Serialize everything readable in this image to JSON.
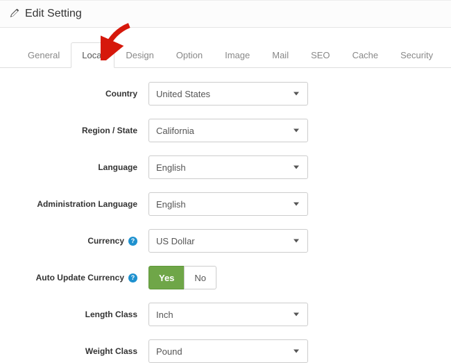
{
  "header": {
    "title": "Edit Setting"
  },
  "tabs": [
    {
      "label": "General"
    },
    {
      "label": "Local"
    },
    {
      "label": "Design"
    },
    {
      "label": "Option"
    },
    {
      "label": "Image"
    },
    {
      "label": "Mail"
    },
    {
      "label": "SEO"
    },
    {
      "label": "Cache"
    },
    {
      "label": "Security"
    }
  ],
  "form": {
    "country": {
      "label": "Country",
      "value": "United States"
    },
    "region": {
      "label": "Region / State",
      "value": "California"
    },
    "language": {
      "label": "Language",
      "value": "English"
    },
    "admin_language": {
      "label": "Administration Language",
      "value": "English"
    },
    "currency": {
      "label": "Currency",
      "value": "US Dollar"
    },
    "auto_update_currency": {
      "label": "Auto Update Currency",
      "yes": "Yes",
      "no": "No"
    },
    "length_class": {
      "label": "Length Class",
      "value": "Inch"
    },
    "weight_class": {
      "label": "Weight Class",
      "value": "Pound"
    }
  },
  "help_glyph": "?"
}
